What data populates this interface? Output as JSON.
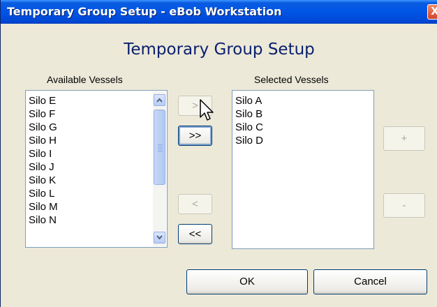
{
  "window": {
    "title": "Temporary Group Setup - eBob Workstation",
    "close_glyph": "X"
  },
  "heading": "Temporary Group Setup",
  "available": {
    "label": "Available Vessels",
    "items": [
      "Silo E",
      "Silo F",
      "Silo G",
      "Silo H",
      "Silo I",
      "Silo J",
      "Silo K",
      "Silo L",
      "Silo M",
      "Silo N"
    ]
  },
  "selected": {
    "label": "Selected Vessels",
    "items": [
      "Silo A",
      "Silo B",
      "Silo C",
      "Silo D"
    ]
  },
  "transfer": {
    "add_one": ">",
    "add_all": ">>",
    "remove_one": "<",
    "remove_all": "<<"
  },
  "order": {
    "up": "+",
    "down": "-"
  },
  "footer": {
    "ok": "OK",
    "cancel": "Cancel"
  },
  "colors": {
    "titlebar": "#0055e5",
    "heading": "#0a1f6e",
    "dialog_bg": "#ece9d8"
  }
}
